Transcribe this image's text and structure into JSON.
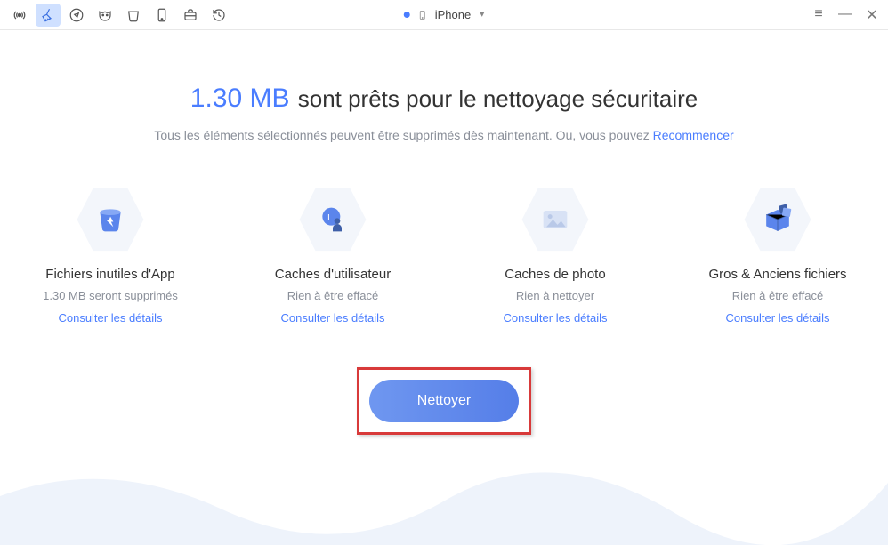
{
  "toolbar": {
    "icons": [
      "radio-icon",
      "broom-icon",
      "compass-icon",
      "mask-icon",
      "trash-icon",
      "device-icon",
      "briefcase-icon",
      "history-icon"
    ]
  },
  "device": {
    "name": "iPhone"
  },
  "headline": {
    "size": "1.30 MB",
    "rest": "sont prêts pour le nettoyage sécuritaire"
  },
  "subtitle": {
    "text": "Tous les éléments sélectionnés peuvent être supprimés dès maintenant. Ou, vous pouvez ",
    "link": "Recommencer"
  },
  "cards": [
    {
      "title": "Fichiers inutiles d'App",
      "sub": "1.30 MB seront supprimés",
      "link": "Consulter les détails"
    },
    {
      "title": "Caches d'utilisateur",
      "sub": "Rien à être effacé",
      "link": "Consulter les détails"
    },
    {
      "title": "Caches de photo",
      "sub": "Rien à nettoyer",
      "link": "Consulter les détails"
    },
    {
      "title": "Gros & Anciens fichiers",
      "sub": "Rien à être effacé",
      "link": "Consulter les détails"
    }
  ],
  "cta": {
    "label": "Nettoyer"
  }
}
